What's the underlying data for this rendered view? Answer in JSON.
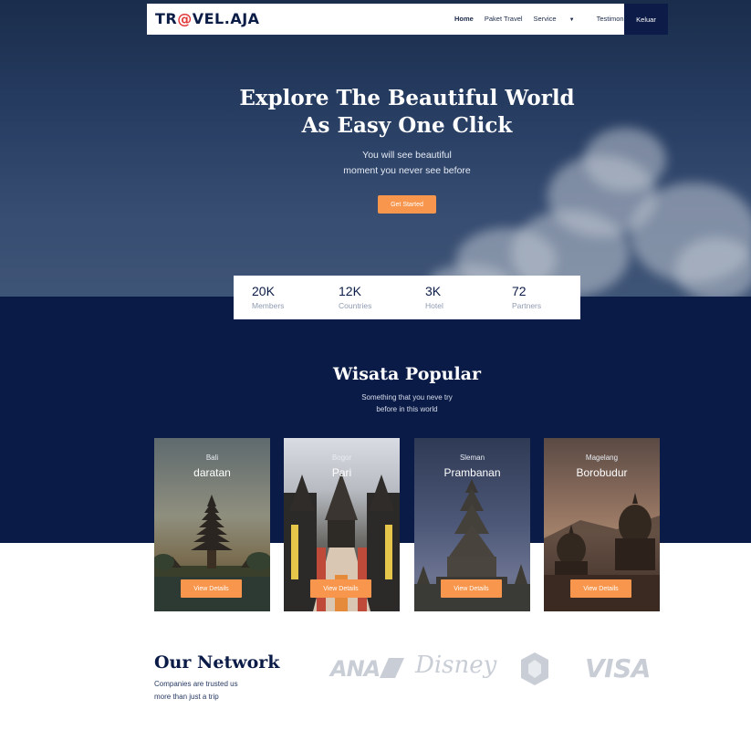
{
  "brand": {
    "logo_prefix": "TR",
    "logo_at": "@",
    "logo_suffix": "VEL.AJA"
  },
  "nav": {
    "items": [
      {
        "label": "Home",
        "active": true
      },
      {
        "label": "Paket Travel",
        "active": false
      },
      {
        "label": "Service",
        "active": false,
        "dropdown": true
      },
      {
        "label": "Testimonial",
        "active": false
      }
    ],
    "logout_label": "Keluar"
  },
  "hero": {
    "title_line1": "Explore The Beautiful World",
    "title_line2": "As Easy One Click",
    "subtitle_line1": "You will see beautiful",
    "subtitle_line2": "moment you never see before",
    "cta_label": "Get Started"
  },
  "stats": [
    {
      "value": "20K",
      "label": "Members"
    },
    {
      "value": "12K",
      "label": "Countries"
    },
    {
      "value": "3K",
      "label": "Hotel"
    },
    {
      "value": "72",
      "label": "Partners"
    }
  ],
  "popular": {
    "title": "Wisata Popular",
    "subtitle_line1": "Something that you neve try",
    "subtitle_line2": "before in this world",
    "cards": [
      {
        "city": "Bali",
        "name": "daratan",
        "button": "View Details"
      },
      {
        "city": "Bogor",
        "name": "Pari",
        "button": "View Details"
      },
      {
        "city": "Sleman",
        "name": "Prambanan",
        "button": "View Details"
      },
      {
        "city": "Magelang",
        "name": "Borobudur",
        "button": "View Details"
      }
    ]
  },
  "network": {
    "title": "Our Network",
    "subtitle_line1": "Companies are trusted us",
    "subtitle_line2": "more than just a trip",
    "partners": [
      "ANA",
      "Disney",
      "VISA"
    ]
  },
  "colors": {
    "navy": "#0b1b47",
    "accent": "#f7964c",
    "logo_at": "#e23a3a"
  }
}
